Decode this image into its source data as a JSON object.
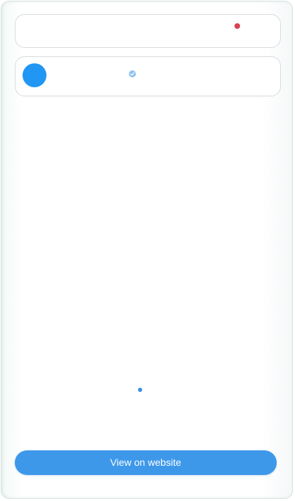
{
  "colors": {
    "accent": "#3d98ea",
    "avatar": "#2196f3",
    "notification_dot": "#d9424f",
    "verified_badge": "#90c3ef",
    "page_dot": "#3b8fe0"
  },
  "header_card": {
    "notification_icon": "notification-dot-icon"
  },
  "profile_card": {
    "avatar_icon": "avatar-icon",
    "verified_icon": "verified-check-icon"
  },
  "pager": {
    "icon": "page-indicator-dot-icon"
  },
  "cta": {
    "label": "View on website"
  }
}
